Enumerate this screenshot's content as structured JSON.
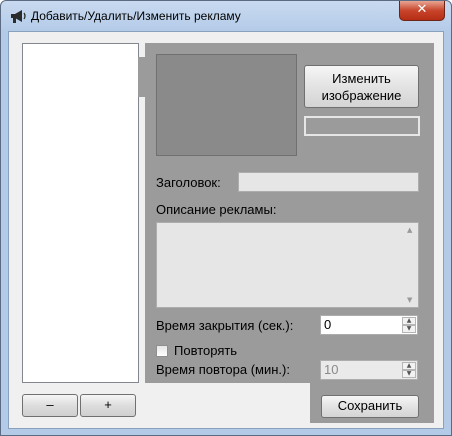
{
  "window": {
    "title": "Добавить/Удалить/Изменить рекламу",
    "icon": "megaphone-icon",
    "close_label": "✕"
  },
  "left_panel": {
    "remove_label": "–",
    "add_label": "+"
  },
  "image_section": {
    "change_image_label": "Изменить\nизображение",
    "image_path_value": ""
  },
  "form": {
    "heading_label": "Заголовок:",
    "heading_value": "",
    "description_label": "Описание рекламы:",
    "description_value": "",
    "close_time_label": "Время закрытия (сек.):",
    "close_time_value": "0",
    "repeat_label": "Повторять",
    "repeat_checked": false,
    "repeat_time_label": "Время повтора (мин.):",
    "repeat_time_value": "10",
    "save_label": "Сохранить"
  }
}
